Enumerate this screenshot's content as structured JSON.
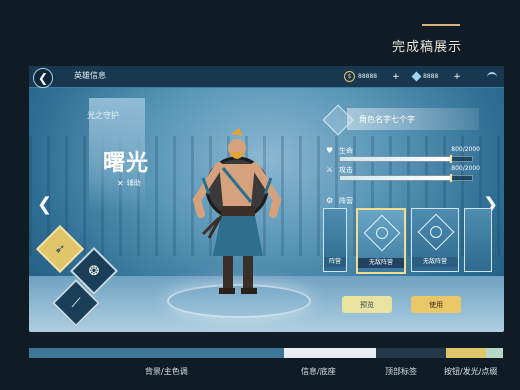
{
  "page": {
    "title": "完成稿展示"
  },
  "topbar": {
    "title": "英雄信息",
    "currency1": {
      "value": "88888",
      "icon": "coin-icon",
      "plus": "+"
    },
    "currency2": {
      "value": "8888",
      "icon": "gem-icon",
      "plus": "+"
    }
  },
  "hero": {
    "subtitle": "光之守护",
    "name": "曙光",
    "role": "辅助"
  },
  "info": {
    "char_name": "角色名字七个字",
    "stats": [
      {
        "label": "生命",
        "value": "800/2000",
        "fill": 0.83
      },
      {
        "label": "攻击",
        "value": "800/2000",
        "fill": 0.83
      }
    ],
    "formation_label": "阵营",
    "cards": [
      {
        "label": "阵营",
        "selected": false
      },
      {
        "label": "无敌阵营",
        "selected": true
      },
      {
        "label": "无敌阵营",
        "selected": false
      },
      {
        "label": "",
        "selected": false
      }
    ],
    "preview_button": "预览",
    "use_button": "使用"
  },
  "skills": [
    {
      "icon": "bird-icon",
      "active": true
    },
    {
      "icon": "wolf-icon",
      "active": false
    },
    {
      "icon": "claw-icon",
      "active": false
    }
  ],
  "palette": {
    "swatches": [
      {
        "color": "#3f7596",
        "ratio": 0.55
      },
      {
        "color": "#e6eef3",
        "ratio": 0.2
      },
      {
        "color": "#253848",
        "ratio": 0.15
      },
      {
        "color": "#e0c56a",
        "ratio": 0.06
      },
      {
        "color": "#b7d8c6",
        "ratio": 0.04
      }
    ],
    "labels": [
      "背景/主色调",
      "信息/底座",
      "顶部标签",
      "按钮/发光/点缀"
    ]
  }
}
